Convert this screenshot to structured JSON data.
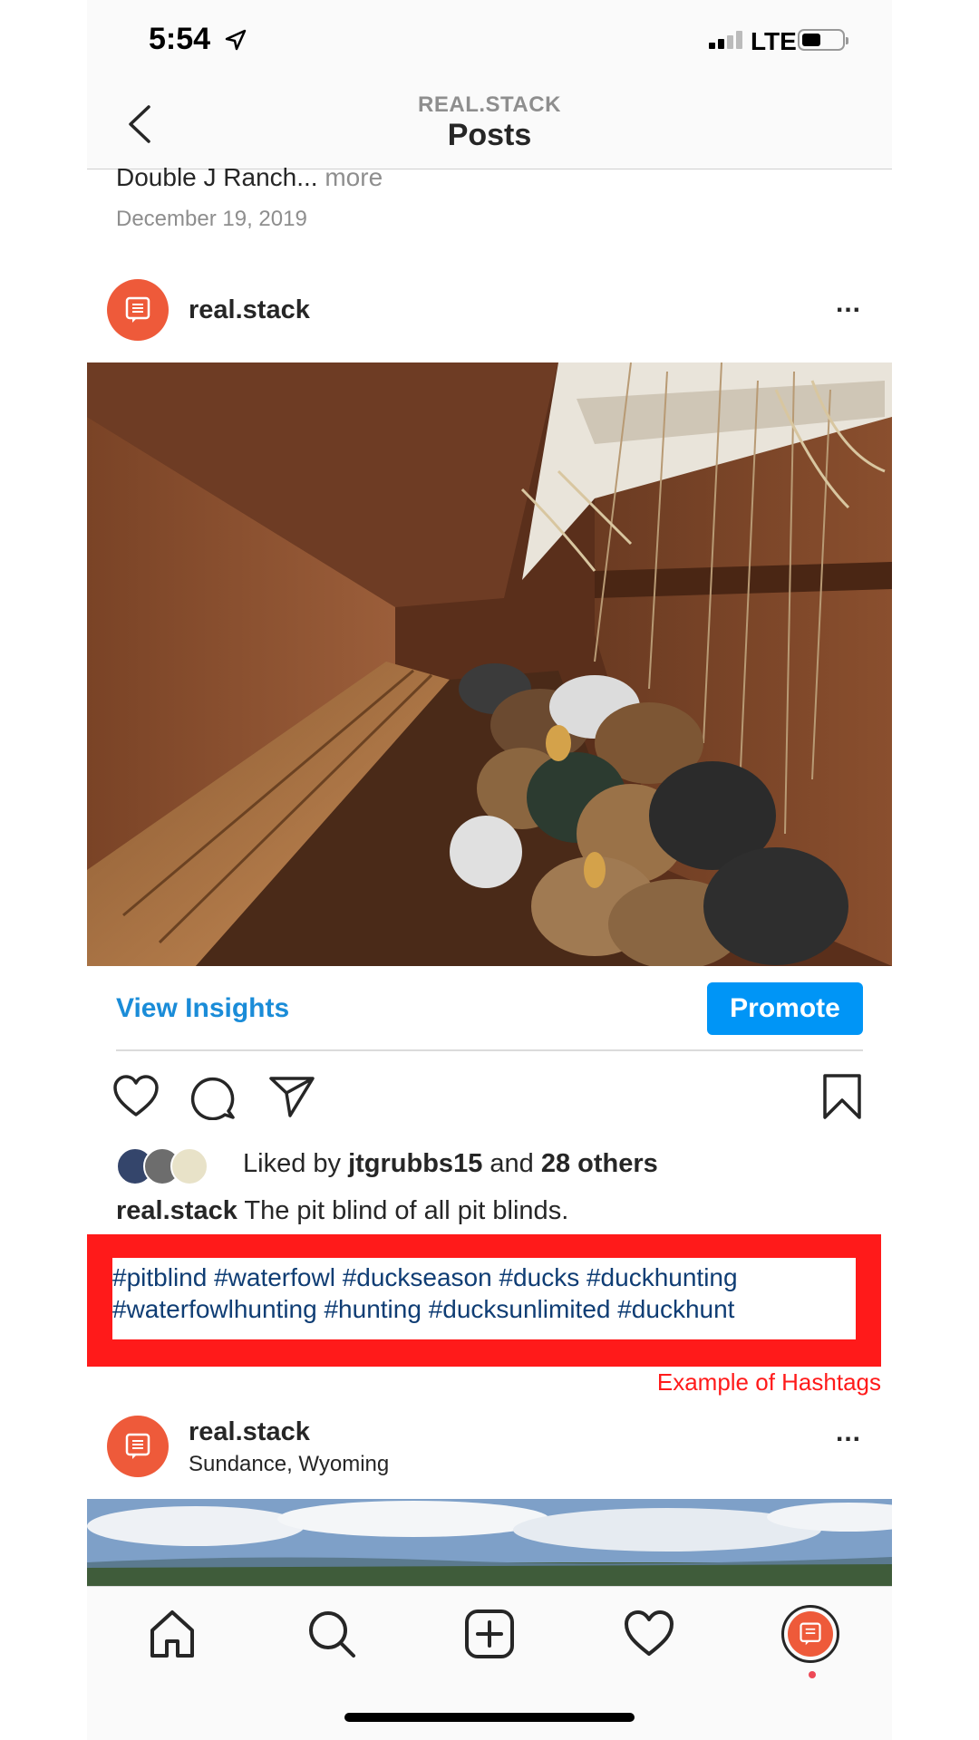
{
  "status_bar": {
    "time": "5:54",
    "network": "LTE"
  },
  "nav": {
    "subtitle": "REAL.STACK",
    "title": "Posts"
  },
  "previous_post": {
    "caption": "Double J Ranch...",
    "more_label": "more",
    "date": "December 19, 2019"
  },
  "post": {
    "username": "real.stack",
    "view_insights": "View Insights",
    "promote": "Promote",
    "liked_by_prefix": "Liked by",
    "liked_by_user": "jtgrubbs15",
    "liked_by_and": "and",
    "liked_by_others": "28 others",
    "caption_user": "real.stack",
    "caption_text": "The pit blind of all pit blinds.",
    "hashtags_line1": "#pitblind #waterfowl #duckseason #ducks #duckhunting",
    "hashtags_line2": "#waterfowlhunting #hunting #ducksunlimited #duckhunt",
    "annotation": "Example of Hashtags",
    "more_icon": "..."
  },
  "next_post": {
    "username": "real.stack",
    "location": "Sundance, Wyoming",
    "more_icon": "..."
  },
  "colors": {
    "accent_blue": "#0095f6",
    "brand_orange": "#ee5a3a",
    "annotation_red": "#ff1a1a",
    "hashtag_blue": "#0f3d74"
  },
  "tabs": [
    "home-icon",
    "search-icon",
    "new-post-icon",
    "activity-heart-icon",
    "profile-icon"
  ]
}
